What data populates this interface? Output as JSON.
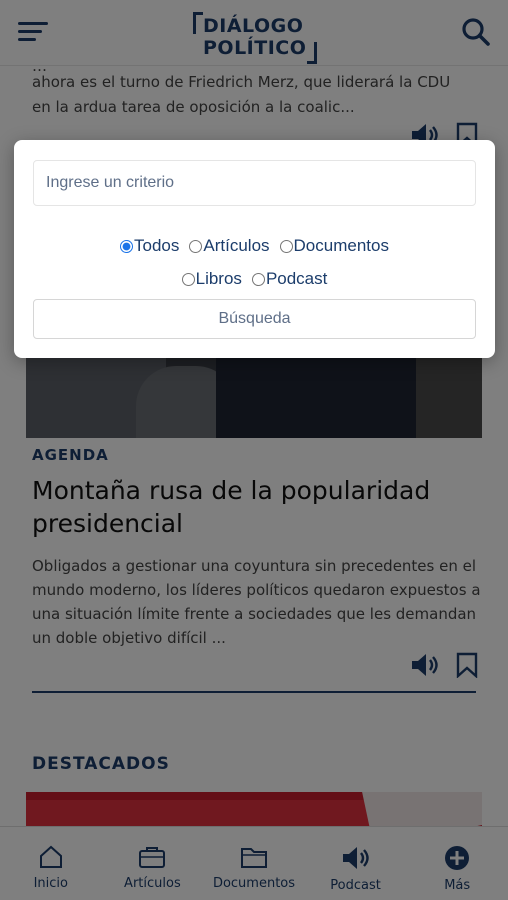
{
  "header": {
    "logo_line1": "DIÁLOGO",
    "logo_line2": "POLÍTICO"
  },
  "previous_article": {
    "summary_cut": "…",
    "summary_line1": "ahora es el turno de Friedrich Merz, que liderará la CDU",
    "summary_line2": "en la ardua tarea de oposición a la coalic..."
  },
  "article": {
    "kicker": "AGENDA",
    "title": "Montaña rusa de la popularidad presidencial",
    "summary": "Obligados a gestionar una coyuntura sin precedentes en el mundo moderno, los líderes políticos quedaron expuestos a una situación límite frente a sociedades que les demandan un doble objetivo difícil ..."
  },
  "featured": {
    "section_title": "DESTACADOS"
  },
  "search_modal": {
    "placeholder": "Ingrese un criterio",
    "value": "",
    "filters": [
      {
        "label": "Todos",
        "checked": true
      },
      {
        "label": "Artículos",
        "checked": false
      },
      {
        "label": "Documentos",
        "checked": false
      },
      {
        "label": "Libros",
        "checked": false
      },
      {
        "label": "Podcast",
        "checked": false
      }
    ],
    "submit_label": "Búsqueda"
  },
  "bottom_nav": {
    "items": [
      {
        "label": "Inicio",
        "icon": "home-icon"
      },
      {
        "label": "Artículos",
        "icon": "briefcase-icon"
      },
      {
        "label": "Documentos",
        "icon": "folder-icon"
      },
      {
        "label": "Podcast",
        "icon": "speaker-icon"
      },
      {
        "label": "Más",
        "icon": "plus-circle-icon"
      }
    ]
  },
  "colors": {
    "brand": "#1c3d6b",
    "overlay": "rgba(0,0,0,0.5)",
    "radio_accent": "#1a73e8"
  }
}
